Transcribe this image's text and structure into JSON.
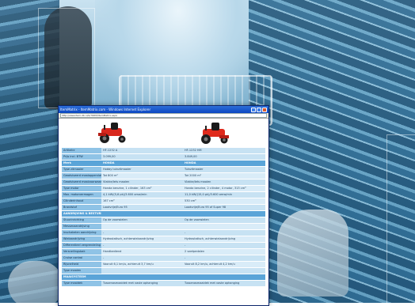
{
  "window": {
    "title": "ItemMatrix - ItemMatrix.com - Windows Internet Explorer",
    "url": "http://www.item-db.nl/k/?KDM/ItemMatrix.aspx"
  },
  "product_images": [
    "red-riding-mower",
    "red-riding-mower"
  ],
  "table": {
    "rows": [
      {
        "label": "Artikelnr",
        "a": "HF-1232 A",
        "b": "HF-1232 HM",
        "style": "row"
      },
      {
        "label": "Prijs incl. BTW",
        "a": "3.099,00",
        "b": "3.849,00",
        "style": "row"
      },
      {
        "label": "Merk",
        "a": "HONDA",
        "b": "HONDA",
        "style": "head"
      },
      {
        "label": "Type zitmaaier",
        "a": "Hobby tuinzitmaaier",
        "b": "Tuinzitmaaier",
        "style": "row"
      },
      {
        "label": "Geadviseerd maaioppervlakte",
        "a": "Tot 800 m²",
        "b": "Tot 2000 m²",
        "style": "alt"
      },
      {
        "label": "Geadviseerd maaivoorwaarden",
        "a": "Vlakke/Iets maaien",
        "b": "Vlakke/Iets maaien",
        "style": "row"
      },
      {
        "label": "Type motor",
        "a": "Honda benzine, 1 cilinder, 163 cm³",
        "b": "Honda benzine, 2 cilinder, 4 motor, 313 cm³",
        "style": "alt"
      },
      {
        "label": "Max. motorvermogen",
        "a": "4,1 kW/(5,6 pk)/3.600 omw/min",
        "b": "11,0 kW/(15,0 pk)/3.600 omw/min",
        "style": "row"
      },
      {
        "label": "Cilinderinhoud",
        "a": "167 cm³",
        "b": "530 cm³",
        "style": "alt"
      },
      {
        "label": "Brandstof",
        "a": "Loodvrije/Euro 95",
        "b": "Loodvrije/Euro 95 of Super 98",
        "style": "row"
      },
      {
        "label": "AANDRIJVING & BESTURING",
        "a": "",
        "b": "",
        "style": "head"
      },
      {
        "label": "Stuurinrichting",
        "a": "Op de voorwielen",
        "b": "Op de voorwielen",
        "style": "row"
      },
      {
        "label": "Messenaandrijving",
        "a": "",
        "b": "",
        "style": "alt"
      },
      {
        "label": "Inschakelen aandrijving",
        "a": "-",
        "b": "-",
        "style": "row"
      },
      {
        "label": "Wielaandrijving",
        "a": "Hydrostatisch, achterwielaandrijving",
        "b": "Hydrostatisch, achterwielaandrijving",
        "style": "alt"
      },
      {
        "label": "Differentieel vergrendeling",
        "a": "-",
        "b": "-",
        "style": "row"
      },
      {
        "label": "Versnellingsbak",
        "a": "Handbediend",
        "b": "2 voetpedalen",
        "style": "alt"
      },
      {
        "label": "Cruise control",
        "a": "-",
        "b": "-",
        "style": "row"
      },
      {
        "label": "Rijsnelheid",
        "a": "Vooruit 6,1 km/u, achteruit 3,7 km/u",
        "b": "Vooruit 8,2 km/u, achteruit 4,2 km/u",
        "style": "alt"
      },
      {
        "label": "Type maaien",
        "a": "",
        "b": "",
        "style": "row"
      },
      {
        "label": "MAAISYSTEEM",
        "a": "",
        "b": "",
        "style": "head"
      },
      {
        "label": "Type maaidek",
        "a": "Tussenasmaaidek met vaste ophanging",
        "b": "Tussenasmaaidek met vaste ophanging",
        "style": "row"
      }
    ]
  }
}
